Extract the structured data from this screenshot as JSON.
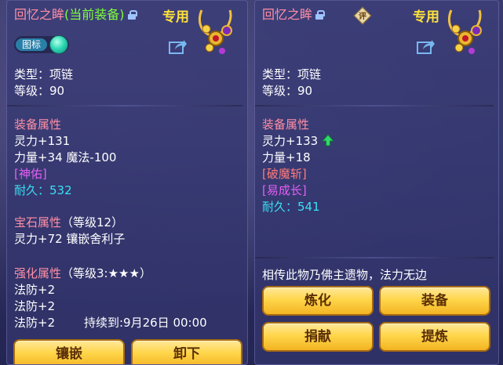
{
  "left": {
    "name": "回忆之眸",
    "current_tag": "(当前装备)",
    "special": "专用",
    "icon_chip_label": "图标",
    "type_line": "类型：项链",
    "level_line": "等级：90",
    "equip_attr_title": "装备属性",
    "attr1": "灵力+131",
    "attr2": "力量+34 魔法-100",
    "skill_tag": "[神佑]",
    "durability": "耐久：532",
    "gem_title": "宝石属性",
    "gem_level": "（等级12）",
    "gem_detail": "灵力+72 镶嵌舍利子",
    "enhance_title": "强化属性",
    "enhance_level": "（等级3:★★★）",
    "def1": "法防+2",
    "def2": "法防+2",
    "def3": "法防+2",
    "expire": "持续到:9月26日 00:00",
    "buttons": {
      "inlay": "镶嵌",
      "unequip": "卸下"
    }
  },
  "right": {
    "name": "回忆之眸",
    "seal_text": "评",
    "special": "专用",
    "type_line": "类型：项链",
    "level_line": "等级：90",
    "equip_attr_title": "装备属性",
    "attr1": "灵力+133",
    "attr2": "力量+18",
    "skill_tag1": "[破魔斩]",
    "skill_tag2": "[易成长]",
    "durability": "耐久：541",
    "description": "相传此物乃佛主遗物，法力无边",
    "buttons": {
      "refine": "炼化",
      "equip": "装备",
      "donate": "捐献",
      "extract": "提炼"
    }
  },
  "colors": {
    "title_pink": "#ff8fa5",
    "tag_green": "#7dff3a",
    "value_cyan": "#39e0f2",
    "skill_magenta": "#e35ff5",
    "special_yellow": "#ffe23a",
    "button_gold": "#ffd64b"
  },
  "icons": [
    "lock-icon",
    "share-icon",
    "necklace-emblem-icon",
    "gem-orb-icon",
    "up-arrow-icon",
    "rating-seal-icon"
  ]
}
